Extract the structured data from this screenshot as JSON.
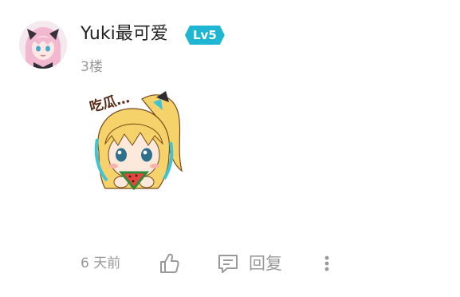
{
  "comment": {
    "username": "Yuki最可爱",
    "level": "Lv5",
    "floor": "3楼",
    "sticker_caption": "吃瓜…",
    "timestamp": "6 天前",
    "actions": {
      "like_icon": "thumbs-up-icon",
      "reply_icon": "comment-icon",
      "reply_label": "回复",
      "more_icon": "more-vertical-icon"
    }
  },
  "colors": {
    "accent_badge": "#1fb6d4",
    "username": "#222222",
    "meta": "#999999"
  }
}
